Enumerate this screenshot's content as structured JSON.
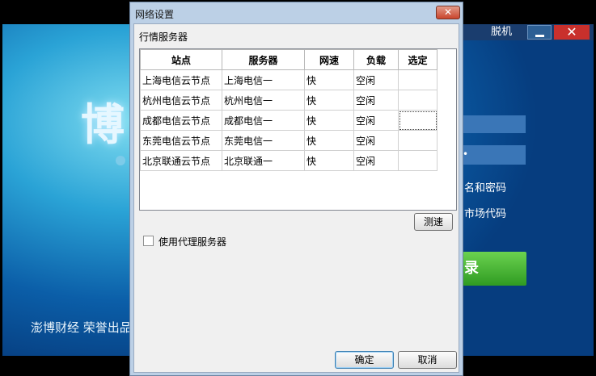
{
  "background_window": {
    "offline_label": "脱机",
    "close_symbol": "✕",
    "brand_partial": "博",
    "slogan": "澎博财经 荣誉出品",
    "password_mask": "•",
    "option_remember": "名和密码",
    "option_market": "市场代码",
    "login_partial": "录"
  },
  "dialog": {
    "title": "网络设置",
    "close_symbol": "✕",
    "section_label": "行情服务器",
    "table": {
      "headers": [
        "站点",
        "服务器",
        "网速",
        "负载",
        "选定"
      ],
      "rows": [
        [
          "上海电信云节点",
          "上海电信一",
          "快",
          "空闲",
          ""
        ],
        [
          "杭州电信云节点",
          "杭州电信一",
          "快",
          "空闲",
          ""
        ],
        [
          "成都电信云节点",
          "成都电信一",
          "快",
          "空闲",
          ""
        ],
        [
          "东莞电信云节点",
          "东莞电信一",
          "快",
          "空闲",
          ""
        ],
        [
          "北京联通云节点",
          "北京联通一",
          "快",
          "空闲",
          ""
        ]
      ]
    },
    "test_button": "测速",
    "proxy_checkbox_label": "使用代理服务器",
    "proxy_checked": false,
    "ok_button": "确定",
    "cancel_button": "取消"
  }
}
